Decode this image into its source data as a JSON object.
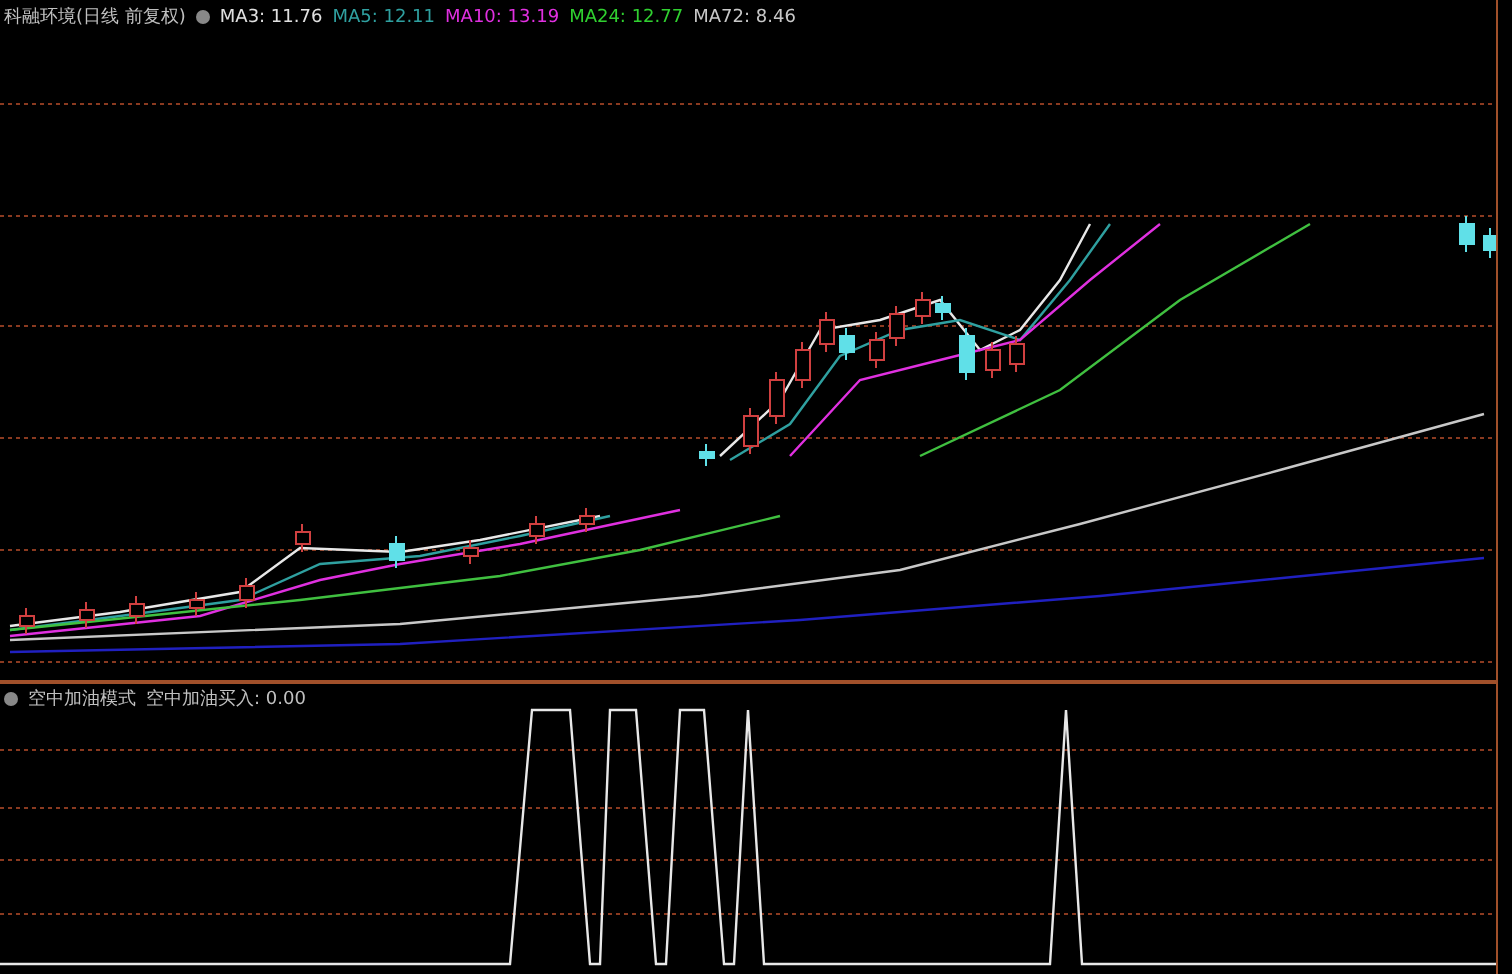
{
  "price_panel": {
    "title": "科融环境(日线 前复权)",
    "averages": [
      {
        "label": "MA3: 11.76",
        "color": "#e0e0e0"
      },
      {
        "label": "MA5: 12.11",
        "color": "#2fa0a0"
      },
      {
        "label": "MA10: 13.19",
        "color": "#e030e0"
      },
      {
        "label": "MA24: 12.77",
        "color": "#30d030"
      },
      {
        "label": "MA72: 8.46",
        "color": "#c8c8c8"
      }
    ]
  },
  "indicator_panel": {
    "title": "空中加油模式",
    "reading": "空中加油买入: 0.00"
  }
}
